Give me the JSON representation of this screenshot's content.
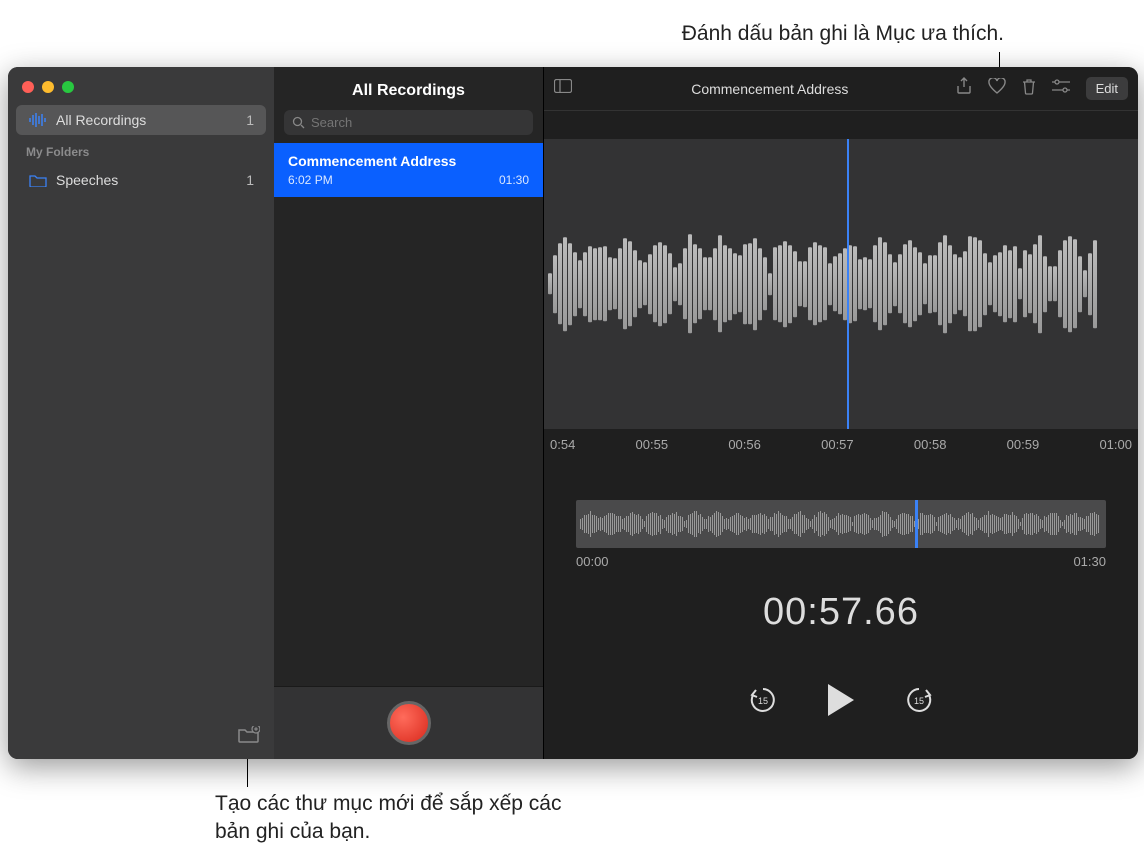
{
  "callouts": {
    "favorite": "Đánh dấu bản ghi là Mục ưa thích.",
    "new_folder": "Tạo các thư mục mới để sắp xếp các bản ghi của bạn."
  },
  "sidebar": {
    "all_recordings": {
      "label": "All Recordings",
      "count": "1"
    },
    "my_folders_header": "My Folders",
    "folders": [
      {
        "label": "Speeches",
        "count": "1"
      }
    ]
  },
  "list": {
    "title": "All Recordings",
    "search_placeholder": "Search",
    "items": [
      {
        "title": "Commencement Address",
        "time": "6:02 PM",
        "duration": "01:30"
      }
    ]
  },
  "player": {
    "title": "Commencement Address",
    "edit_label": "Edit",
    "ruler": [
      "0:54",
      "00:55",
      "00:56",
      "00:57",
      "00:58",
      "00:59",
      "01:00"
    ],
    "mini_start": "00:00",
    "mini_end": "01:30",
    "current_time": "00:57.66",
    "skip_back_label": "15",
    "skip_fwd_label": "15"
  }
}
